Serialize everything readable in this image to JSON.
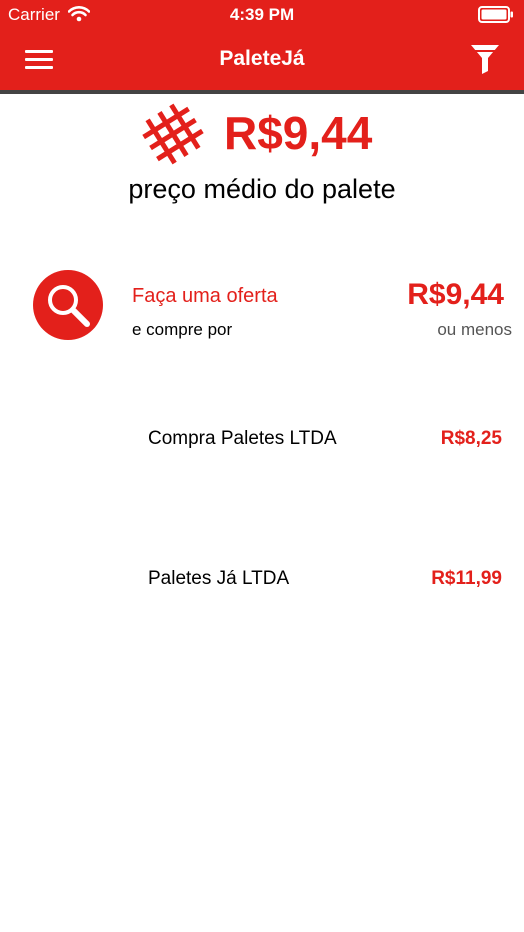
{
  "status_bar": {
    "carrier": "Carrier",
    "time": "4:39 PM",
    "wifi_icon": "wifi-icon",
    "battery_icon": "battery-icon"
  },
  "nav": {
    "title": "PaleteJá",
    "menu_icon": "hamburger-menu-icon",
    "filter_icon": "filter-funnel-icon"
  },
  "summary": {
    "icon": "pallet-icon",
    "average_price": "R$9,44",
    "caption": "preço médio do palete"
  },
  "offer": {
    "icon": "search-magnifier-icon",
    "title": "Faça uma oferta",
    "subtitle": "e compre por",
    "price": "R$9,44",
    "price_note": "ou menos"
  },
  "suppliers": [
    {
      "name": "Compra Paletes LTDA",
      "price": "R$8,25"
    },
    {
      "name": "Paletes Já LTDA",
      "price": "R$11,99"
    }
  ],
  "colors": {
    "accent": "#e3201b",
    "text": "#000000",
    "muted": "#555555",
    "background": "#ffffff"
  }
}
